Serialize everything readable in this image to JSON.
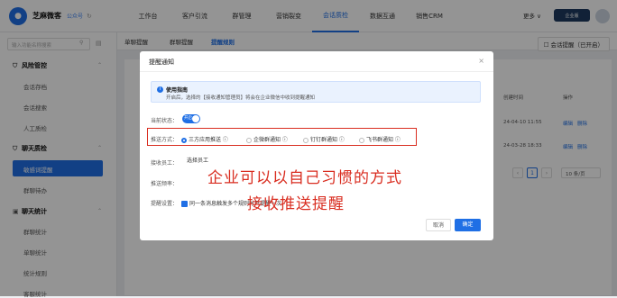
{
  "brand": {
    "name": "芝麻微客",
    "pub": "公众号"
  },
  "nav": [
    "工作台",
    "客户引流",
    "群管理",
    "营销裂变",
    "会话质检",
    "数据互通",
    "销售CRM"
  ],
  "nav_active": "会话质检",
  "more": "更多 ∨",
  "user_badge": "企业版",
  "search_placeholder": "输入功能名称搜索",
  "sidebar": {
    "g1": "风险管控",
    "g1_items": [
      "会话存档",
      "会话搜索",
      "人工质检"
    ],
    "g2": "聊天质检",
    "g2_items": [
      "敏感词提醒",
      "群聊待办"
    ],
    "g2_active": "敏感词提醒",
    "g3": "聊天统计",
    "g3_items": [
      "群聊统计",
      "单聊统计",
      "统计规则",
      "客服统计"
    ]
  },
  "subtabs": [
    "单聊提醒",
    "群聊提醒",
    "提醒规则"
  ],
  "subtab_active": "提醒规则",
  "convo_btn": "☐ 会话提醒（已开启）",
  "table": {
    "headers": [
      "创建时间",
      "操作"
    ],
    "rows": [
      {
        "time": "24-04-10 11:55",
        "edit": "编辑",
        "del": "删除"
      },
      {
        "time": "24-03-28 18:33",
        "edit": "编辑",
        "del": "删除"
      }
    ],
    "page": "1",
    "per_page": "10 条/页"
  },
  "modal": {
    "title": "提醒通知",
    "notice_title": "使用指南",
    "notice_text": "开启后，选择的【接收通知管理员】将会在企业微信中收到提醒通知",
    "status_label": "当前状态：",
    "toggle": "开启",
    "method_label": "推送方式：",
    "methods": [
      "三方应用推送 ⓘ",
      "企微群通知 ⓘ",
      "钉钉群通知 ⓘ",
      "飞书群通知 ⓘ"
    ],
    "receiver_label": "接收员工：",
    "receiver_value": "选择员工",
    "freq_label": "推送频率：",
    "setting_label": "提醒设置：",
    "setting_text": "同一条消息触发多个规则时只提醒一次",
    "cancel": "取消",
    "ok": "确定"
  },
  "annotation": [
    "企业可以以自己习惯的方式",
    "接收推送提醒"
  ]
}
